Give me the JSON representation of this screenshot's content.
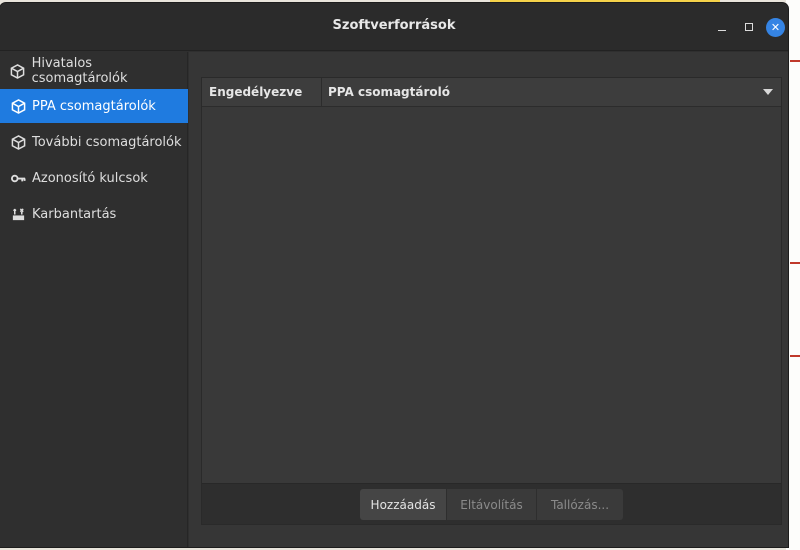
{
  "window": {
    "title": "Szoftverforrások",
    "controls": {
      "minimize": "minimize-icon",
      "maximize": "maximize-icon",
      "close": "close-icon"
    }
  },
  "sidebar": {
    "items": [
      {
        "label": "Hivatalos csomagtárolók",
        "icon": "package-icon",
        "active": false
      },
      {
        "label": "PPA csomagtárolók",
        "icon": "package-icon",
        "active": true
      },
      {
        "label": "További csomagtárolók",
        "icon": "package-icon",
        "active": false
      },
      {
        "label": "Azonosító kulcsok",
        "icon": "key-icon",
        "active": false
      },
      {
        "label": "Karbantartás",
        "icon": "maintenance-icon",
        "active": false
      }
    ]
  },
  "main": {
    "table": {
      "columns": [
        "Engedélyezve",
        "PPA csomagtároló"
      ],
      "rows": []
    },
    "toolbar": {
      "add_label": "Hozzáadás",
      "remove_label": "Eltávolítás",
      "browse_label": "Tallózás..."
    }
  },
  "colors": {
    "accent": "#1f7be0",
    "close_button": "#3584e4",
    "window_bg": "#2f2f2f"
  }
}
